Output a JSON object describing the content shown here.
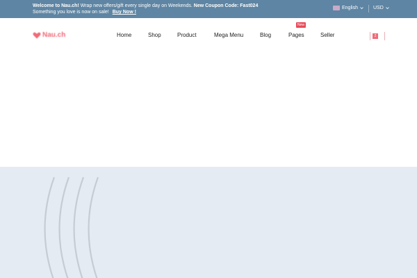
{
  "topbar": {
    "welcome_bold": "Welcome to Nau.ch!",
    "welcome_text": "Wrap new offers/gift every single day on Weekends.",
    "coupon_bold": "New Coupon Code: Fast024",
    "sale_text": "Something you love is now on sale!",
    "sale_link": "Buy Now !",
    "language": "English",
    "currency": "USD"
  },
  "header": {
    "logo_text": "Nau.ch",
    "nav": [
      {
        "label": "Home"
      },
      {
        "label": "Shop"
      },
      {
        "label": "Product"
      },
      {
        "label": "Mega Menu"
      },
      {
        "label": "Blog"
      },
      {
        "label": "Pages",
        "badge": "New"
      },
      {
        "label": "Seller"
      }
    ],
    "cart_count": "2"
  },
  "colors": {
    "topbar_bg": "#5e85a3",
    "accent": "#f06a78",
    "badge": "#e84a5a",
    "hero_bg": "#e4ebf2"
  }
}
